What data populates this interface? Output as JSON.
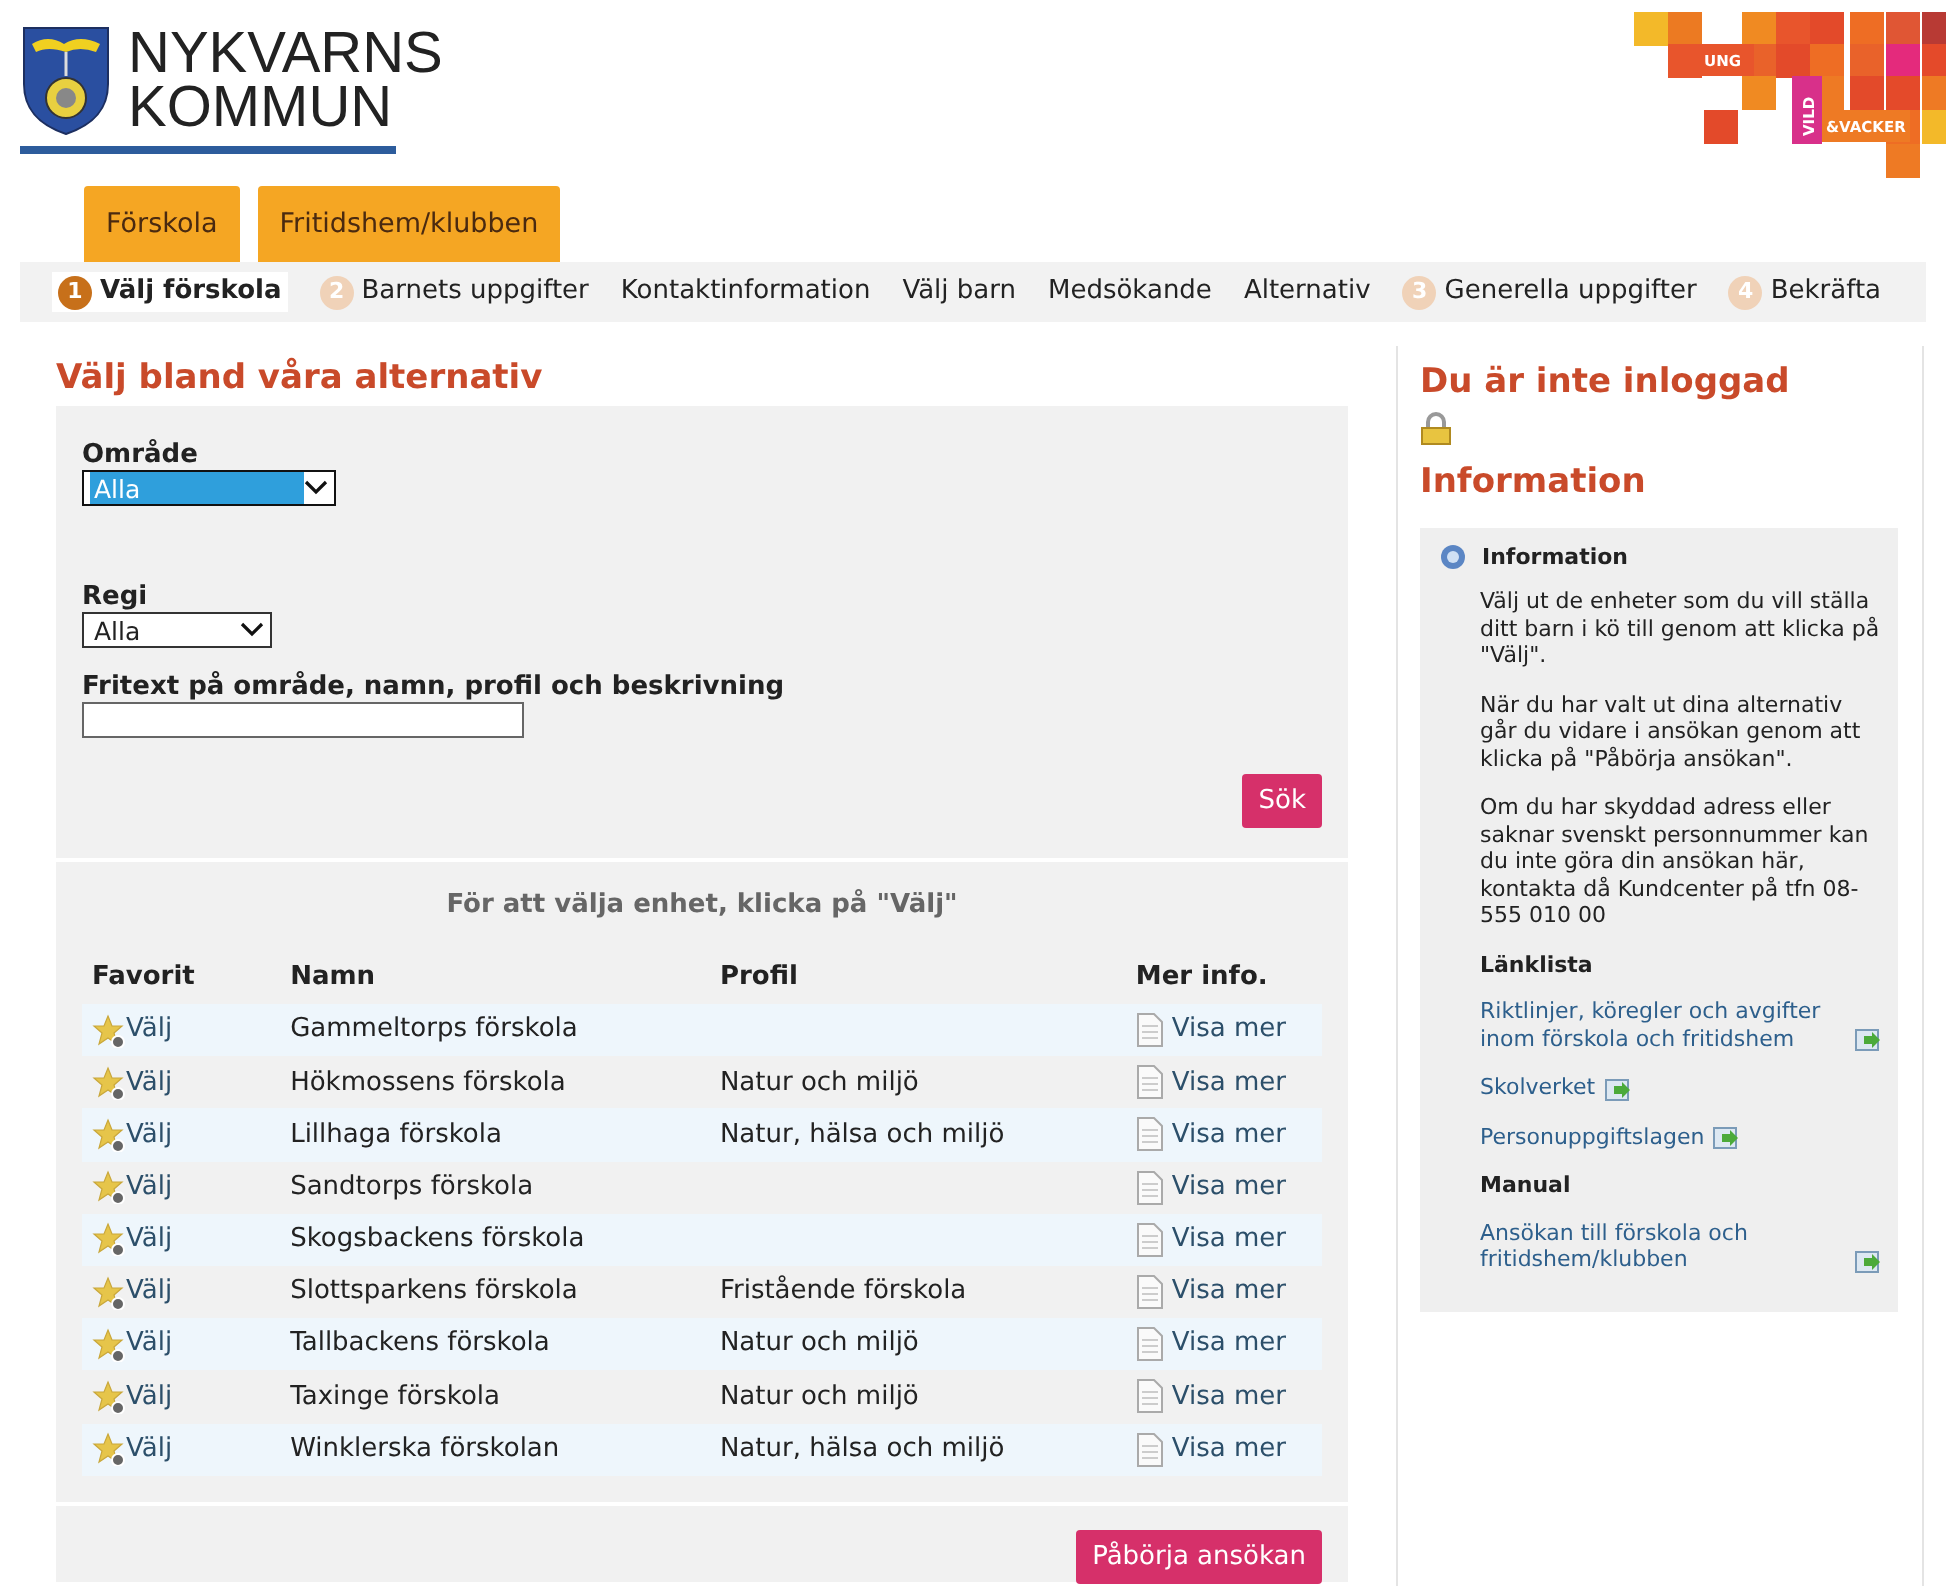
{
  "header": {
    "logo_lines": [
      "NYKVARNS",
      "KOMMUN"
    ],
    "banner_words": [
      "UNG",
      "VILD",
      "&VACKER"
    ]
  },
  "tabs": [
    "Förskola",
    "Fritidshem/klubben"
  ],
  "steps": [
    {
      "number": "1",
      "label": "Välj förskola",
      "selected": true
    },
    {
      "number": "2",
      "label": "Barnets uppgifter",
      "selected": false
    },
    {
      "label": "Kontaktinformation",
      "selected": false
    },
    {
      "label": "Välj barn",
      "selected": false
    },
    {
      "label": "Medsökande",
      "selected": false
    },
    {
      "label": "Alternativ",
      "selected": false
    },
    {
      "number": "3",
      "label": "Generella uppgifter",
      "selected": false
    },
    {
      "number": "4",
      "label": "Bekräfta",
      "selected": false
    }
  ],
  "main": {
    "title": "Välj bland våra alternativ",
    "filters": [
      {
        "kind": "select",
        "label": "Område",
        "value": "Alla",
        "focused": true
      },
      {
        "kind": "select",
        "label": "Regi",
        "value": "Alla",
        "focused": false
      },
      {
        "kind": "text",
        "label": "Fritext på område, namn, profil och beskrivning"
      }
    ],
    "search_button": "Sök",
    "hint": "För att välja enhet, klicka på \"Välj\"",
    "columns": [
      "Favorit",
      "Namn",
      "Profil",
      "Mer info."
    ],
    "rows": [
      {
        "choose": "Välj",
        "name": "Gammeltorps förskola",
        "more": "Visa mer"
      },
      {
        "choose": "Välj",
        "name": "Hökmossens förskola",
        "profile": "Natur och miljö",
        "more": "Visa mer"
      },
      {
        "choose": "Välj",
        "name": "Lillhaga förskola",
        "profile": "Natur, hälsa och miljö",
        "more": "Visa mer"
      },
      {
        "choose": "Välj",
        "name": "Sandtorps förskola",
        "more": "Visa mer"
      },
      {
        "choose": "Välj",
        "name": "Skogsbackens förskola",
        "more": "Visa mer"
      },
      {
        "choose": "Välj",
        "name": "Slottsparkens förskola",
        "profile": "Fristående förskola",
        "more": "Visa mer"
      },
      {
        "choose": "Välj",
        "name": "Tallbackens förskola",
        "profile": "Natur och miljö",
        "more": "Visa mer"
      },
      {
        "choose": "Välj",
        "name": "Taxinge förskola",
        "profile": "Natur och miljö",
        "more": "Visa mer"
      },
      {
        "choose": "Välj",
        "name": "Winklerska förskolan",
        "profile": "Natur, hälsa och miljö",
        "more": "Visa mer"
      }
    ],
    "start_button": "Påbörja ansökan"
  },
  "sidebar": {
    "login_status": "Du är inte inloggad",
    "info_heading": "Information",
    "box": {
      "title": "Information",
      "paragraphs": [
        "Välj ut de enheter som du vill ställa ditt barn i kö till genom att klicka på \"Välj\".",
        "När du har valt ut dina alternativ går du vidare i ansökan genom att klicka på \"Påbörja ansökan\".",
        "Om du har skyddad adress eller saknar svenskt personnummer kan du inte göra din ansökan här, kontakta då Kundcenter på tfn 08-555 010 00"
      ],
      "sections": [
        {
          "heading": "Länklista",
          "links": [
            "Riktlinjer, köregler och avgifter inom förskola och fritidshem",
            "Skolverket",
            "Personuppgiftslagen"
          ]
        },
        {
          "heading": "Manual",
          "links": [
            "Ansökan till förskola och fritidshem/klubben"
          ]
        }
      ]
    }
  }
}
